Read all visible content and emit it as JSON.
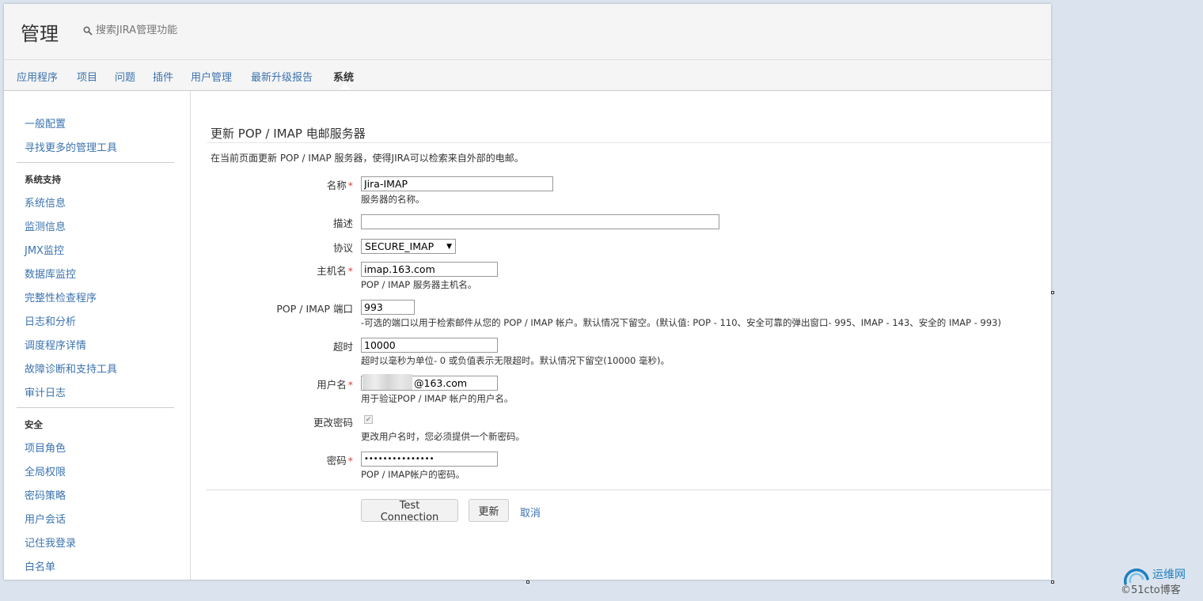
{
  "header": {
    "title": "管理",
    "search_placeholder": "搜索JIRA管理功能"
  },
  "nav": {
    "tabs": [
      "应用程序",
      "项目",
      "问题",
      "插件",
      "用户管理",
      "最新升级报告",
      "系统"
    ],
    "active": "系统"
  },
  "sidebar": {
    "top_items": [
      "一般配置",
      "寻找更多的管理工具"
    ],
    "sections": [
      {
        "heading": "系统支持",
        "items": [
          "系统信息",
          "监测信息",
          "JMX监控",
          "数据库监控",
          "完整性检查程序",
          "日志和分析",
          "调度程序详情",
          "故障诊断和支持工具",
          "审计日志"
        ]
      },
      {
        "heading": "安全",
        "items": [
          "项目角色",
          "全局权限",
          "密码策略",
          "用户会话",
          "记住我登录",
          "白名单"
        ]
      }
    ]
  },
  "form": {
    "title": "更新 POP / IMAP 电邮服务器",
    "description": "在当前页面更新 POP / IMAP 服务器，使得JIRA可以检索来自外部的电邮。",
    "required_mark": "*",
    "fields": {
      "name": {
        "label": "名称",
        "value": "Jira-IMAP",
        "hint": "服务器的名称。"
      },
      "desc": {
        "label": "描述",
        "value": ""
      },
      "protocol": {
        "label": "协议",
        "value": "SECURE_IMAP"
      },
      "host": {
        "label": "主机名",
        "value": "imap.163.com",
        "hint": "POP / IMAP 服务器主机名。"
      },
      "port": {
        "label": "POP / IMAP 端口",
        "value": "993",
        "hint": "-可选的端口以用于检索邮件从您的 POP / IMAP 帐户。默认情况下留空。(默认值: POP - 110、安全可靠的弹出窗口- 995、IMAP - 143、安全的 IMAP - 993)"
      },
      "timeout": {
        "label": "超时",
        "value": "10000",
        "hint": "超时以毫秒为单位- 0 或负值表示无限超时。默认情况下留空(10000 毫秒)。"
      },
      "username": {
        "label": "用户名",
        "value": "@163.com",
        "hint": "用于验证POP / IMAP 帐户的用户名。"
      },
      "change_password": {
        "label": "更改密码",
        "checked": true,
        "hint": "更改用户名时，您必须提供一个新密码。"
      },
      "password": {
        "label": "密码",
        "value": "•••••••••••••••",
        "hint": "POP / IMAP帐户的密码。"
      }
    },
    "buttons": {
      "test": "Test Connection",
      "update": "更新",
      "cancel": "取消"
    }
  },
  "watermark": {
    "site": "运维网",
    "url": "©51cto博客"
  },
  "colors": {
    "link": "#3b73af",
    "required": "#d04437",
    "header_bg": "#f5f5f5",
    "page_bg": "#dbe4ee"
  }
}
